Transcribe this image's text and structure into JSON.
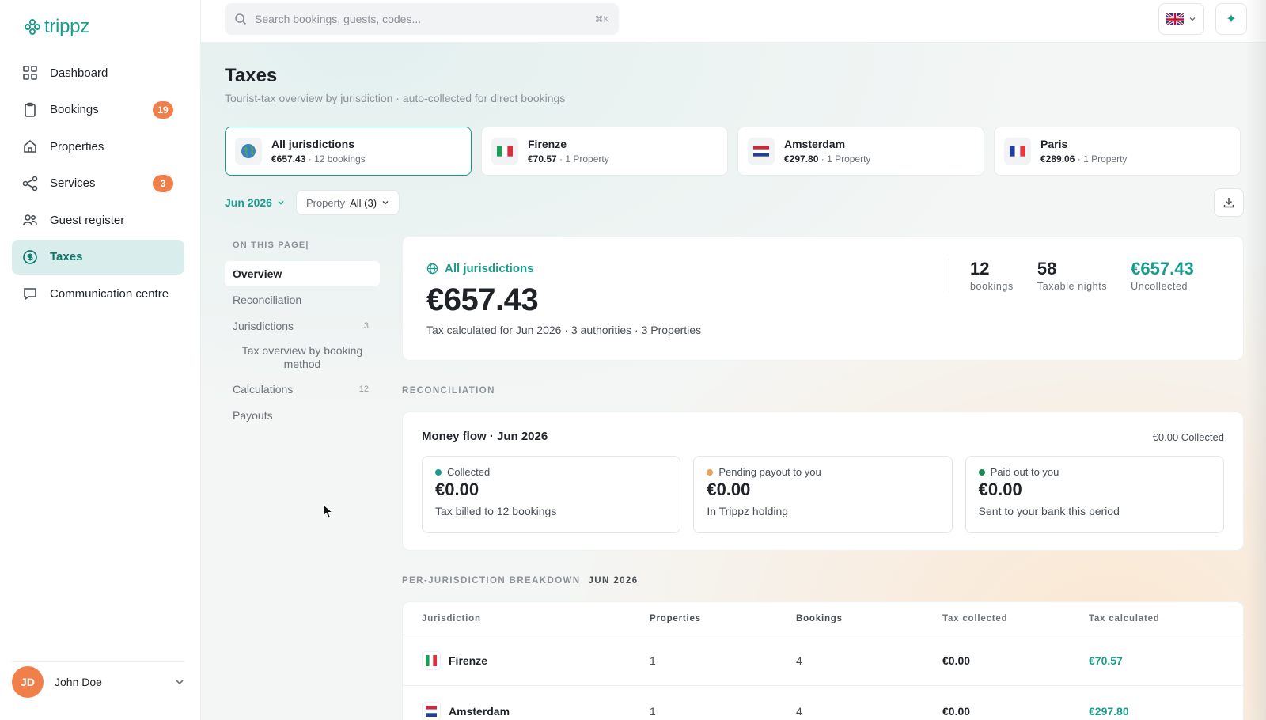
{
  "brand": {
    "name": "trippz"
  },
  "nav": {
    "items": [
      {
        "label": "Dashboard",
        "icon": "grid-icon"
      },
      {
        "label": "Bookings",
        "icon": "clipboard-icon",
        "badge": "19"
      },
      {
        "label": "Properties",
        "icon": "home-icon"
      },
      {
        "label": "Services",
        "icon": "share-icon",
        "badge": "3"
      },
      {
        "label": "Guest register",
        "icon": "users-icon"
      },
      {
        "label": "Taxes",
        "icon": "coin-icon",
        "active": true
      },
      {
        "label": "Communication centre",
        "icon": "chat-icon"
      }
    ]
  },
  "user": {
    "initials": "JD",
    "name": "John Doe"
  },
  "search": {
    "placeholder": "Search bookings, guests, codes...",
    "shortcut": "⌘K"
  },
  "page": {
    "title": "Taxes",
    "subtitle": "Tourist-tax overview by jurisdiction · auto-collected for direct bookings"
  },
  "jurisdiction_cards": [
    {
      "name": "All jurisdictions",
      "amount": "€657.43",
      "meta": "· 12 bookings",
      "flag": "globe-icon",
      "active": true
    },
    {
      "name": "Firenze",
      "amount": "€70.57",
      "meta": "· 1 Property",
      "flag": "italy-flag-icon"
    },
    {
      "name": "Amsterdam",
      "amount": "€297.80",
      "meta": "· 1 Property",
      "flag": "netherlands-flag-icon"
    },
    {
      "name": "Paris",
      "amount": "€289.06",
      "meta": "· 1 Property",
      "flag": "france-flag-icon"
    }
  ],
  "filters": {
    "month": "Jun 2026",
    "property_label": "Property",
    "property_value": "All (3)"
  },
  "toc": {
    "heading": "ON THIS PAGE|",
    "items": [
      {
        "label": "Overview",
        "active": true
      },
      {
        "label": "Reconciliation"
      },
      {
        "label": "Jurisdictions",
        "count": "3"
      },
      {
        "label": "Tax overview by booking method",
        "sub": true
      },
      {
        "label": "Calculations",
        "count": "12"
      },
      {
        "label": "Payouts"
      }
    ]
  },
  "summary": {
    "label": "All jurisdictions",
    "amount": "€657.43",
    "description": "Tax calculated for Jun 2026 · 3 authorities · 3 Properties",
    "stats": [
      {
        "value": "12",
        "label": "bookings"
      },
      {
        "value": "58",
        "label": "Taxable nights"
      },
      {
        "value": "€657.43",
        "label": "Uncollected",
        "accent": true
      }
    ]
  },
  "reconciliation": {
    "heading": "RECONCILIATION",
    "title": "Money flow · Jun 2026",
    "collected_total": "€0.00 Collected",
    "cards": [
      {
        "label": "Collected",
        "amount": "€0.00",
        "desc": "Tax billed to 12 bookings",
        "color": "#1a9c8c"
      },
      {
        "label": "Pending payout to you",
        "amount": "€0.00",
        "desc": "In Trippz holding",
        "color": "#e8a25a"
      },
      {
        "label": "Paid out to you",
        "amount": "€0.00",
        "desc": "Sent to your bank this period",
        "color": "#178a52"
      }
    ]
  },
  "breakdown": {
    "heading": "PER-JURISDICTION BREAKDOWN",
    "period": "JUN 2026",
    "columns": [
      "Jurisdiction",
      "Properties",
      "Bookings",
      "Tax collected",
      "Tax calculated"
    ],
    "rows": [
      {
        "jurisdiction": "Firenze",
        "flag": "italy-flag-icon",
        "properties": "1",
        "bookings": "4",
        "collected": "€0.00",
        "calculated": "€70.57"
      },
      {
        "jurisdiction": "Amsterdam",
        "flag": "netherlands-flag-icon",
        "properties": "1",
        "bookings": "4",
        "collected": "€0.00",
        "calculated": "€297.80"
      }
    ]
  },
  "colors": {
    "accent": "#1a9c8c",
    "badge": "#f07f4a"
  }
}
